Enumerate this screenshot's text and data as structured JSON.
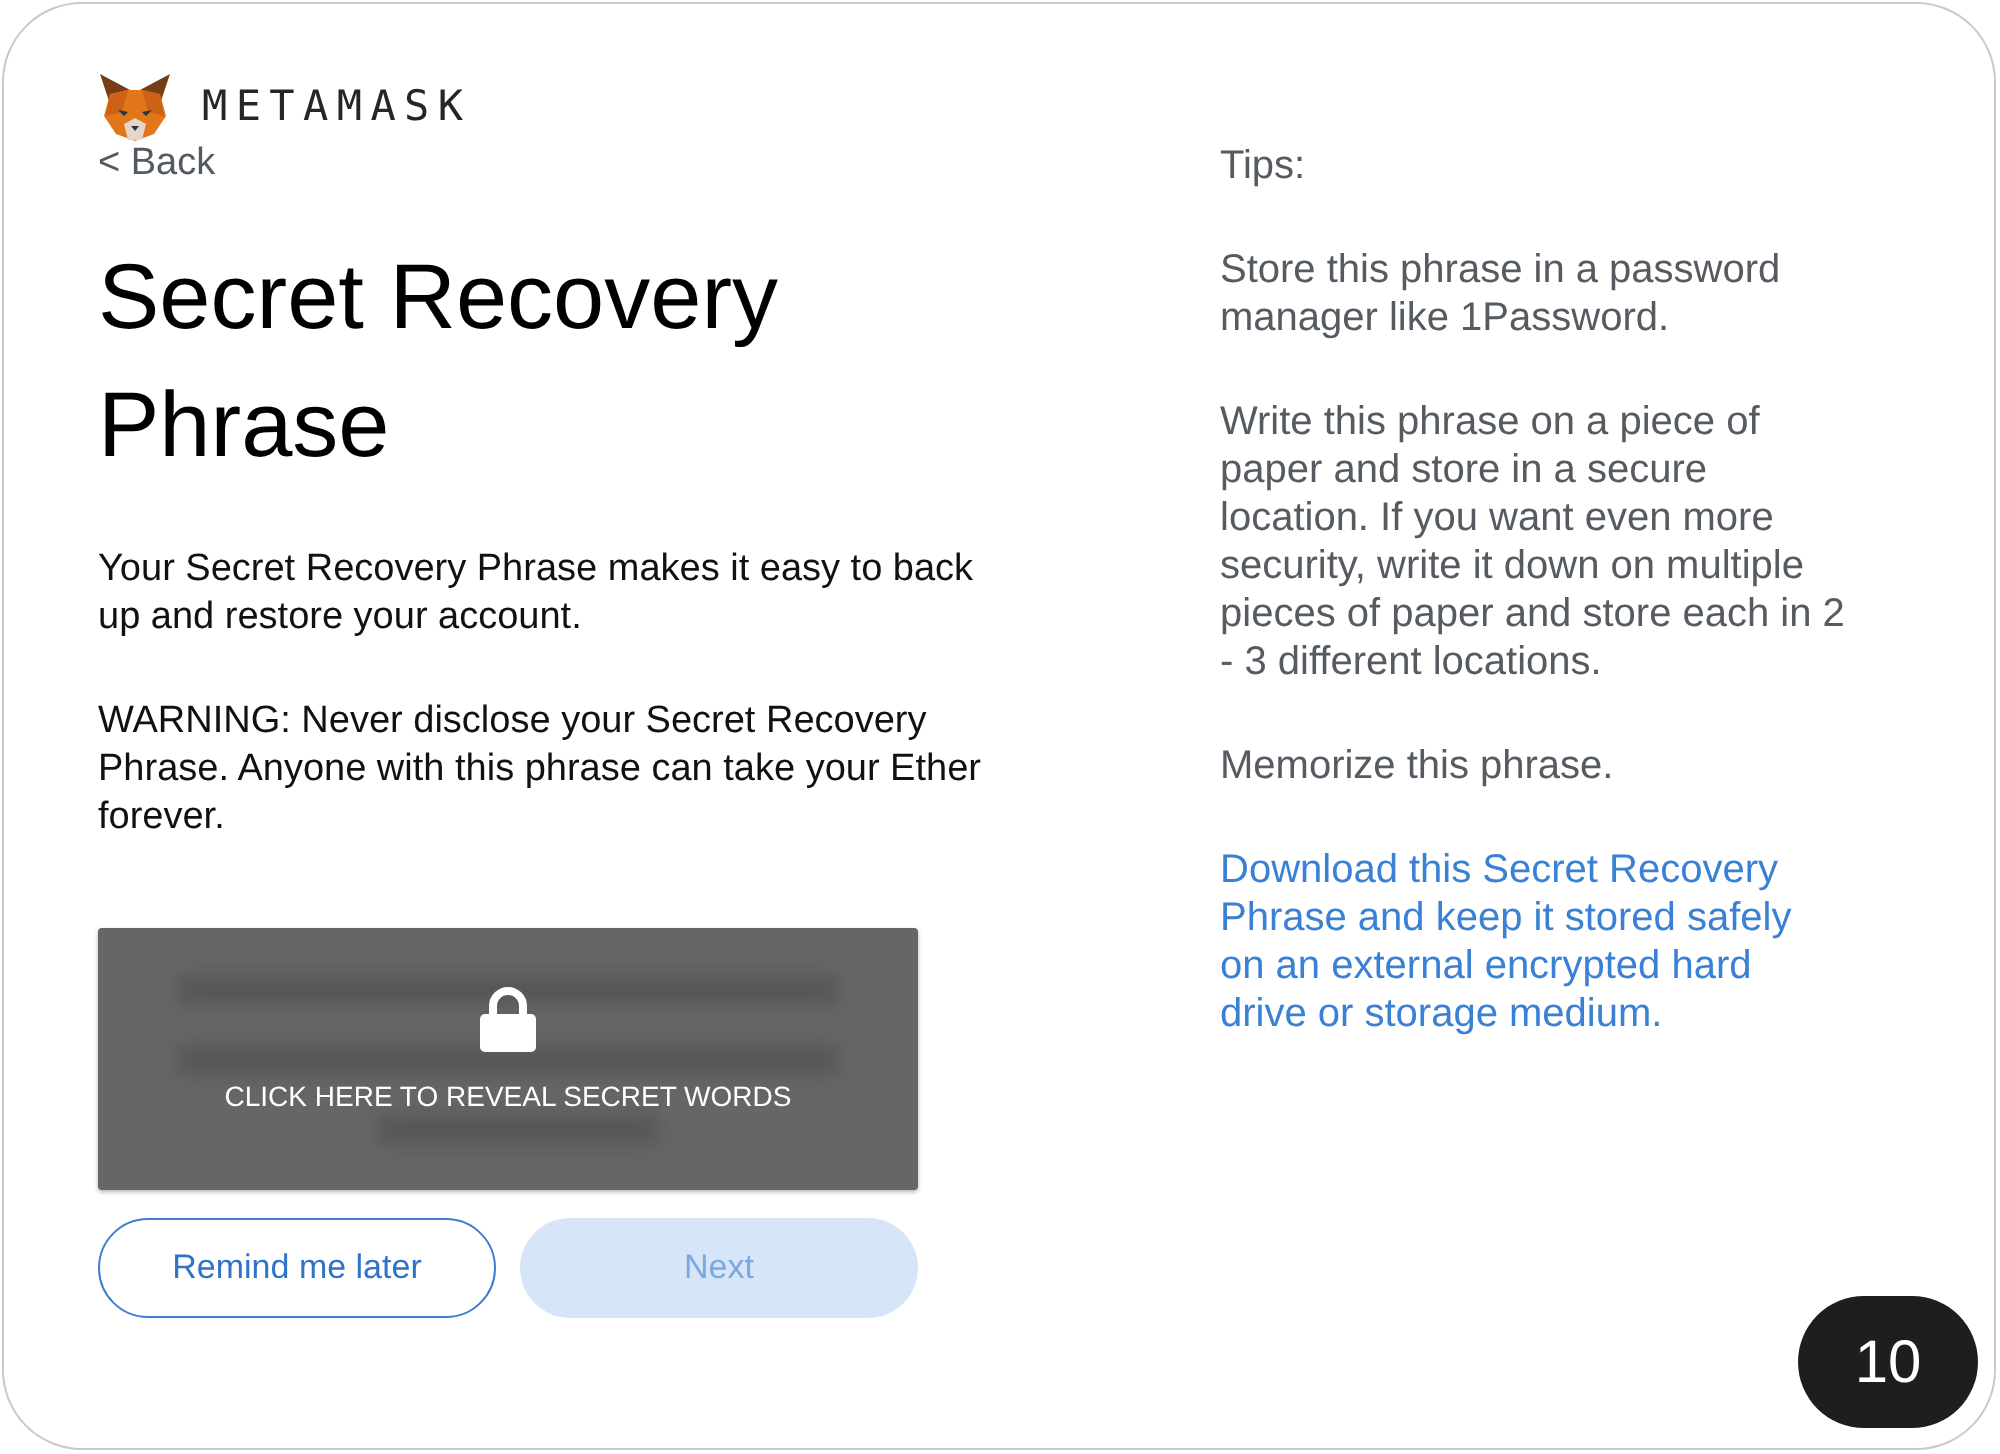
{
  "logo": {
    "wordmark": "METAMASK"
  },
  "back_link": {
    "label": "< Back"
  },
  "title": "Secret Recovery Phrase",
  "intro": "Your Secret Recovery Phrase makes it easy to back up and restore your account.",
  "warning": "WARNING: Never disclose your Secret Recovery Phrase. Anyone with this phrase can take your Ether forever.",
  "reveal_panel": {
    "label": "CLICK HERE TO REVEAL SECRET WORDS"
  },
  "buttons": [
    {
      "label": "Remind me later",
      "kind": "secondary",
      "disabled": false
    },
    {
      "label": "Next",
      "kind": "primary",
      "disabled": true
    }
  ],
  "tips": {
    "heading": "Tips:",
    "items": [
      {
        "kind": "text",
        "text": "Store this phrase in a password manager like 1Password."
      },
      {
        "kind": "text",
        "text": "Write this phrase on a piece of paper and store in a secure location. If you want even more security, write it down on multiple pieces of paper and store each in 2 - 3 different locations."
      },
      {
        "kind": "text",
        "text": "Memorize this phrase."
      },
      {
        "kind": "link",
        "text": "Download this Secret Recovery Phrase and keep it stored safely on an external encrypted hard drive or storage medium."
      }
    ]
  },
  "step_badge": "10"
}
